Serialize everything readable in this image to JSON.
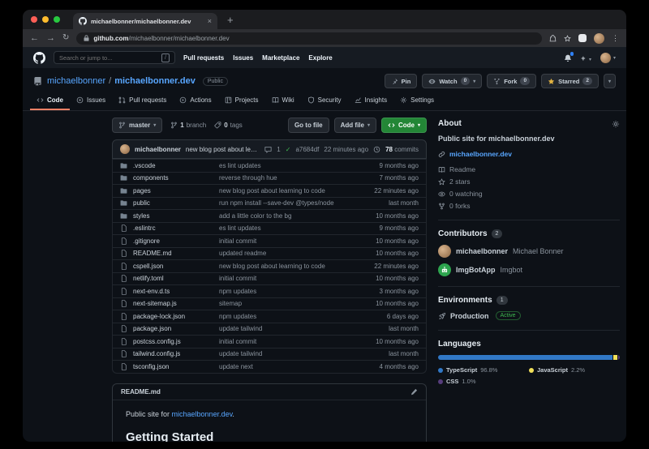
{
  "browser": {
    "tab_title": "michaelbonner/michaelbonner.dev",
    "url_host": "github.com",
    "url_path": "/michaelbonner/michaelbonner.dev"
  },
  "gh_header": {
    "search_placeholder": "Search or jump to...",
    "search_shortcut": "/",
    "nav": [
      "Pull requests",
      "Issues",
      "Marketplace",
      "Explore"
    ]
  },
  "repo_header": {
    "owner": "michaelbonner",
    "separator": "/",
    "repo": "michaelbonner.dev",
    "visibility": "Public",
    "pin_label": "Pin",
    "watch_label": "Watch",
    "watch_count": "0",
    "fork_label": "Fork",
    "fork_count": "0",
    "star_label": "Starred",
    "star_count": "2"
  },
  "repo_tabs": [
    {
      "label": "Code",
      "active": true
    },
    {
      "label": "Issues"
    },
    {
      "label": "Pull requests"
    },
    {
      "label": "Actions"
    },
    {
      "label": "Projects"
    },
    {
      "label": "Wiki"
    },
    {
      "label": "Security"
    },
    {
      "label": "Insights"
    },
    {
      "label": "Settings"
    }
  ],
  "toolbar": {
    "branch": "master",
    "branch_count": "1",
    "branch_count_label": "branch",
    "tag_count": "0",
    "tag_count_label": "tags",
    "go_to_file": "Go to file",
    "add_file": "Add file",
    "code_button": "Code"
  },
  "commit_bar": {
    "author": "michaelbonner",
    "message": "new blog post about learning to code",
    "comment_count": "1",
    "check": "✓",
    "hash": "a7684df",
    "time": "22 minutes ago",
    "commit_count": "78",
    "commit_count_label": "commits"
  },
  "files": [
    {
      "name": ".vscode",
      "type": "folder",
      "message": "es lint updates",
      "age": "9 months ago"
    },
    {
      "name": "components",
      "type": "folder",
      "message": "reverse through hue",
      "age": "7 months ago"
    },
    {
      "name": "pages",
      "type": "folder",
      "message": "new blog post about learning to code",
      "age": "22 minutes ago"
    },
    {
      "name": "public",
      "type": "folder",
      "message": "run npm install --save-dev @types/node",
      "age": "last month"
    },
    {
      "name": "styles",
      "type": "folder",
      "message": "add a little color to the bg",
      "age": "10 months ago"
    },
    {
      "name": ".eslintrc",
      "type": "file",
      "message": "es lint updates",
      "age": "9 months ago"
    },
    {
      "name": ".gitignore",
      "type": "file",
      "message": "initial commit",
      "age": "10 months ago"
    },
    {
      "name": "README.md",
      "type": "file",
      "message": "updated readme",
      "age": "10 months ago"
    },
    {
      "name": "cspell.json",
      "type": "file",
      "message": "new blog post about learning to code",
      "age": "22 minutes ago"
    },
    {
      "name": "netlify.toml",
      "type": "file",
      "message": "initial commit",
      "age": "10 months ago"
    },
    {
      "name": "next-env.d.ts",
      "type": "file",
      "message": "npm updates",
      "age": "3 months ago"
    },
    {
      "name": "next-sitemap.js",
      "type": "file",
      "message": "sitemap",
      "age": "10 months ago"
    },
    {
      "name": "package-lock.json",
      "type": "file",
      "message": "npm updates",
      "age": "6 days ago"
    },
    {
      "name": "package.json",
      "type": "file",
      "message": "update tailwind",
      "age": "last month"
    },
    {
      "name": "postcss.config.js",
      "type": "file",
      "message": "initial commit",
      "age": "10 months ago"
    },
    {
      "name": "tailwind.config.js",
      "type": "file",
      "message": "update tailwind",
      "age": "last month"
    },
    {
      "name": "tsconfig.json",
      "type": "file",
      "message": "update next",
      "age": "4 months ago"
    }
  ],
  "readme": {
    "title": "README.md",
    "intro_prefix": "Public site for ",
    "intro_link": "michaelbonner.dev",
    "intro_suffix": ".",
    "heading": "Getting Started"
  },
  "sidebar": {
    "about": {
      "title": "About",
      "description": "Public site for michaelbonner.dev",
      "website": "michaelbonner.dev",
      "stats": [
        {
          "label": "Readme"
        },
        {
          "label": "2 stars"
        },
        {
          "label": "0 watching"
        },
        {
          "label": "0 forks"
        }
      ]
    },
    "contributors": {
      "title": "Contributors",
      "count": "2",
      "items": [
        {
          "username": "michaelbonner",
          "name": "Michael Bonner"
        },
        {
          "username": "ImgBotApp",
          "name": "Imgbot"
        }
      ]
    },
    "environments": {
      "title": "Environments",
      "count": "1",
      "name": "Production",
      "status": "Active"
    },
    "languages": {
      "title": "Languages",
      "items": [
        {
          "name": "TypeScript",
          "percent": "96.8%",
          "color": "#3178c6"
        },
        {
          "name": "JavaScript",
          "percent": "2.2%",
          "color": "#f1e05a"
        },
        {
          "name": "CSS",
          "percent": "1.0%",
          "color": "#563d7c"
        }
      ]
    }
  },
  "colors": {
    "link_blue": "#58a6ff",
    "button_green": "#238636",
    "star_yellow": "#e3b341",
    "tab_underline_orange": "#f78166",
    "check_green": "#3fb950"
  }
}
